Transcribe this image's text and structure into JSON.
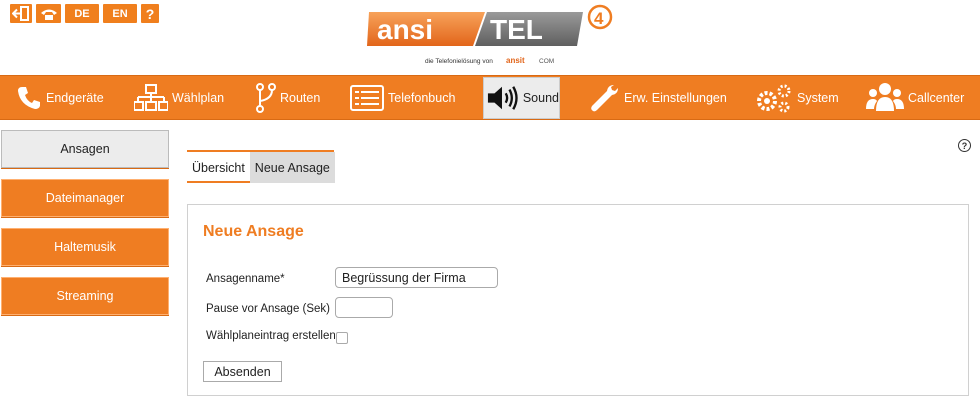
{
  "top_bar": {
    "lang_de": "DE",
    "lang_en": "EN",
    "help": "?",
    "icons": [
      "logout-icon",
      "phone-icon",
      "language-de",
      "language-en",
      "help-icon"
    ]
  },
  "logo": {
    "left_text": "ansi",
    "right_text": "TEL",
    "version": "4",
    "tagline": "die Telefonielösung von",
    "brand": "ansit",
    "brand_suffix": "COM"
  },
  "nav": {
    "items": [
      {
        "label": "Endgeräte",
        "icon": "phone-icon"
      },
      {
        "label": "Wählplan",
        "icon": "hierarchy-icon"
      },
      {
        "label": "Routen",
        "icon": "route-icon"
      },
      {
        "label": "Telefonbuch",
        "icon": "phonebook-icon"
      },
      {
        "label": "Sound",
        "icon": "speaker-icon",
        "active": true
      },
      {
        "label": "Erw. Einstellungen",
        "icon": "wrench-icon"
      },
      {
        "label": "System",
        "icon": "gears-icon"
      },
      {
        "label": "Callcenter",
        "icon": "users-icon"
      }
    ]
  },
  "sidebar": {
    "items": [
      {
        "label": "Ansagen",
        "active": true
      },
      {
        "label": "Dateimanager"
      },
      {
        "label": "Haltemusik"
      },
      {
        "label": "Streaming"
      }
    ]
  },
  "tabs": [
    {
      "label": "Übersicht"
    },
    {
      "label": "Neue Ansage",
      "active": true
    }
  ],
  "form": {
    "title": "Neue Ansage",
    "name_label": "Ansagenname*",
    "name_value": "Begrüssung der Firma",
    "pause_label": "Pause vor Ansage (Sek)",
    "pause_value": "",
    "dialplan_label": "Wählplaneintrag erstellen",
    "dialplan_checked": false,
    "submit_label": "Absenden"
  },
  "help_icon_text": "?",
  "colors": {
    "accent": "#ef7d22",
    "active_bg": "#ececec"
  }
}
